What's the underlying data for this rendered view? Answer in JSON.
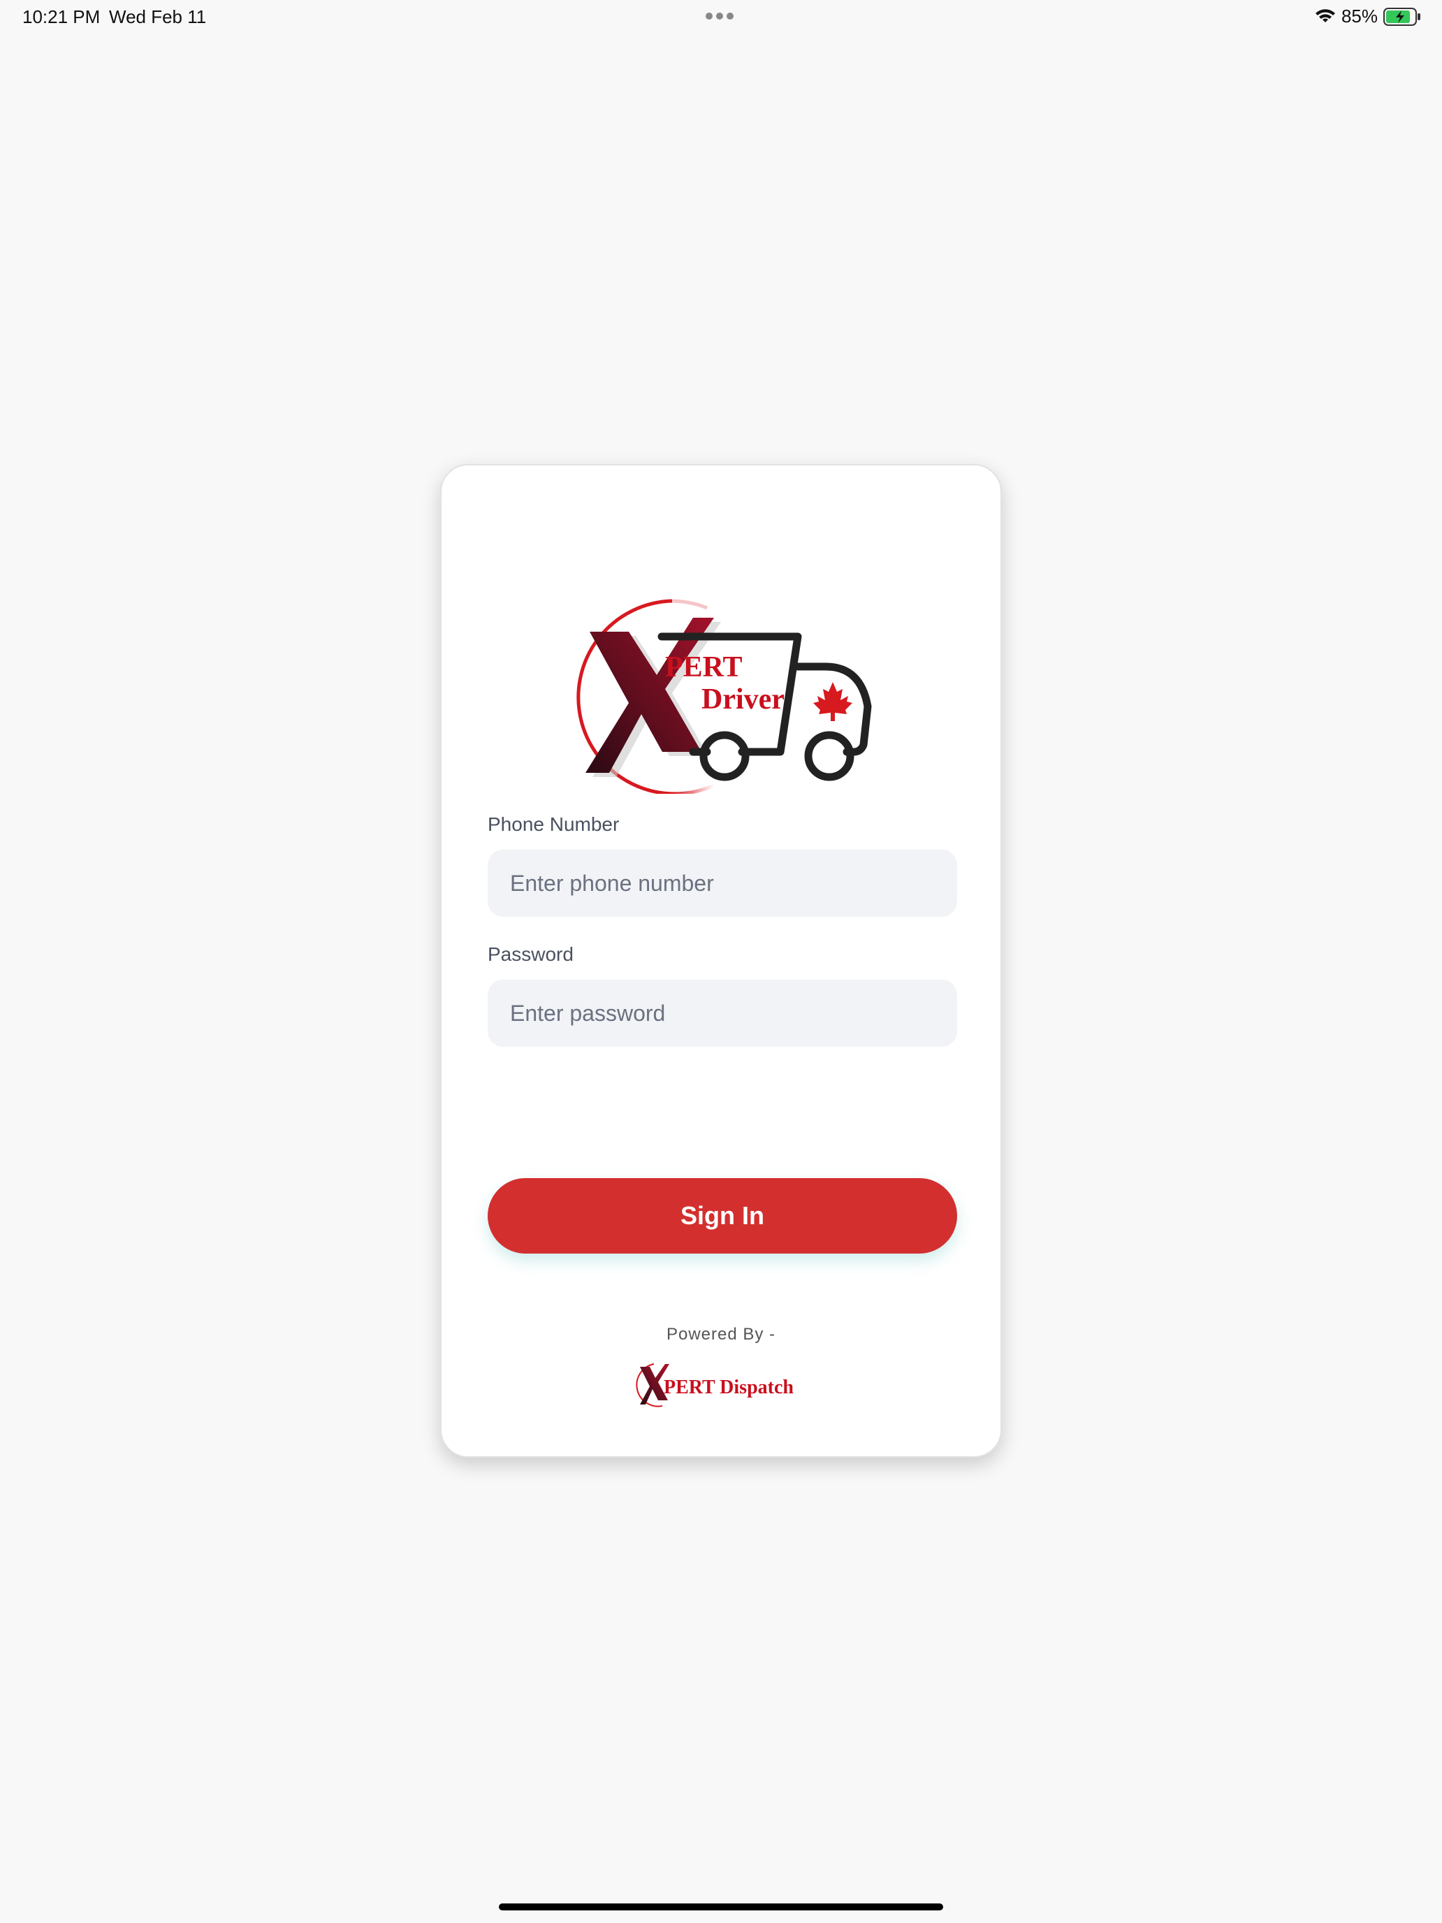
{
  "status_bar": {
    "time": "10:21 PM",
    "date": "Wed Feb 11",
    "battery_percent": "85%",
    "battery_level": 0.85
  },
  "logo": {
    "line1": "PERT",
    "line2": "Driver",
    "letter": "X",
    "icon": "truck-icon"
  },
  "form": {
    "phone_label": "Phone Number",
    "phone_placeholder": "Enter phone number",
    "password_label": "Password",
    "password_placeholder": "Enter password",
    "signin_label": "Sign In"
  },
  "footer": {
    "powered_by": "Powered By -",
    "dispatch_letter": "X",
    "dispatch_name": "PERT Dispatch"
  },
  "colors": {
    "accent": "#d32f2f",
    "logo_dark": "#4a0e1c",
    "background": "#f8f8f8",
    "input_bg": "#f1f3f6"
  }
}
